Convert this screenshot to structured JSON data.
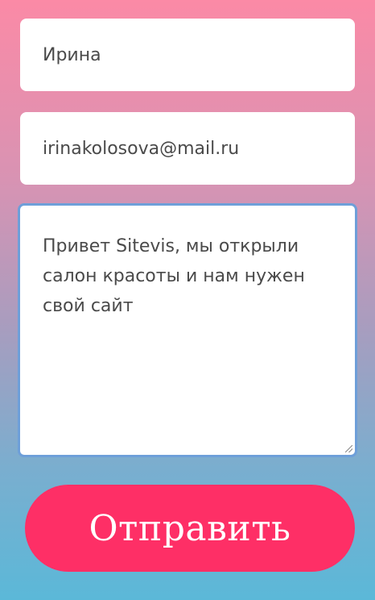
{
  "form": {
    "name_value": "Ирина",
    "email_value": "irinakolosova@mail.ru",
    "message_value": "Привет Sitevis, мы открыли салон красоты и нам нужен свой сайт",
    "submit_label": "Отправить"
  },
  "colors": {
    "button": "#fe2f66",
    "focus_border": "#6e9fd9",
    "gradient_top": "#fb8aa6",
    "gradient_bottom": "#5bb8d8"
  }
}
